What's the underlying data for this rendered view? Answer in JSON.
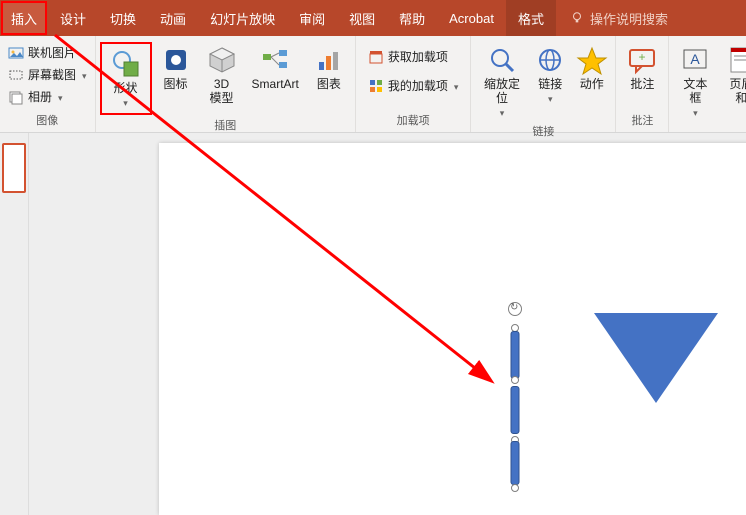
{
  "tabs": {
    "insert": "插入",
    "design": "设计",
    "transition": "切换",
    "animation": "动画",
    "slideshow": "幻灯片放映",
    "review": "审阅",
    "view": "视图",
    "help": "帮助",
    "acrobat": "Acrobat",
    "format": "格式",
    "search": "操作说明搜索"
  },
  "ribbon": {
    "image_group": {
      "online_pics": "联机图片",
      "screenshot": "屏幕截图",
      "album": "相册",
      "label": "图像"
    },
    "illustration_group": {
      "shapes": "形状",
      "icons": "图标",
      "model3d": "3D\n模型",
      "smartart": "SmartArt",
      "chart": "图表",
      "label": "插图"
    },
    "addins_group": {
      "get_addins": "获取加载项",
      "my_addins": "我的加载项",
      "label": "加载项"
    },
    "links_group": {
      "zoom": "缩放定位",
      "link": "链接",
      "action": "动作",
      "label": "链接"
    },
    "comment_group": {
      "comment": "批注",
      "label": "批注"
    },
    "text_group": {
      "textbox": "文本框",
      "header_footer": "页眉和"
    }
  }
}
